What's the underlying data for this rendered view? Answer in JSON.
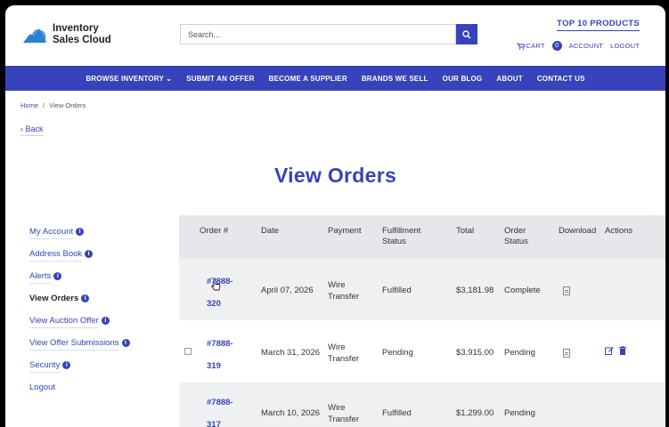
{
  "brand": {
    "line1": "Inventory",
    "line2": "Sales Cloud"
  },
  "search": {
    "placeholder": "Search..."
  },
  "header": {
    "top_link": "TOP 10 PRODUCTS",
    "cart_label": "CART",
    "cart_count": "0",
    "account_label": "ACCOUNT",
    "logout_label": "LOGOUT"
  },
  "nav": {
    "items": [
      "BROWSE INVENTORY",
      "SUBMIT AN OFFER",
      "BECOME A SUPPLIER",
      "BRANDS WE SELL",
      "OUR BLOG",
      "ABOUT",
      "CONTACT US"
    ]
  },
  "breadcrumb": {
    "home": "Home",
    "current": "View Orders"
  },
  "back_label": "‹ Back",
  "page_title": "View Orders",
  "sidebar": {
    "items": [
      {
        "label": "My Account",
        "info": true
      },
      {
        "label": "Address Book",
        "info": true
      },
      {
        "label": "Alerts",
        "info": true
      },
      {
        "label": "View Orders",
        "info": true
      },
      {
        "label": "View Auction Offer",
        "info": true
      },
      {
        "label": "View Offer Submissions",
        "info": true
      },
      {
        "label": "Security",
        "info": true
      },
      {
        "label": "Logout",
        "info": false
      }
    ]
  },
  "table": {
    "headers": {
      "order": "Order #",
      "date": "Date",
      "payment": "Payment",
      "fulfillment_1": "Fulfillment",
      "fulfillment_2": "Status",
      "total": "Total",
      "order_status_1": "Order",
      "order_status_2": "Status",
      "download": "Download",
      "actions": "Actions"
    },
    "rows": [
      {
        "order_1": "#7888-",
        "order_2": "320",
        "date": "April 07, 2026",
        "payment_1": "Wire",
        "payment_2": "Transfer",
        "fulfillment": "Fulfilled",
        "total": "$3,181.98",
        "status": "Complete"
      },
      {
        "order_1": "#7888-",
        "order_2": "319",
        "date": "March 31, 2026",
        "payment_1": "Wire",
        "payment_2": "Transfer",
        "fulfillment": "Pending",
        "total": "$3,915.00",
        "status": "Pending"
      },
      {
        "order_1": "#7888-",
        "order_2": "317",
        "date": "March 10, 2026",
        "payment_1": "Wire",
        "payment_2": "Transfer",
        "fulfillment": "Fulfilled",
        "total": "$1,299.00",
        "status": "Pending"
      }
    ]
  },
  "colors": {
    "brand_blue": "#3643ba",
    "header_grey": "#e6e7ea"
  }
}
